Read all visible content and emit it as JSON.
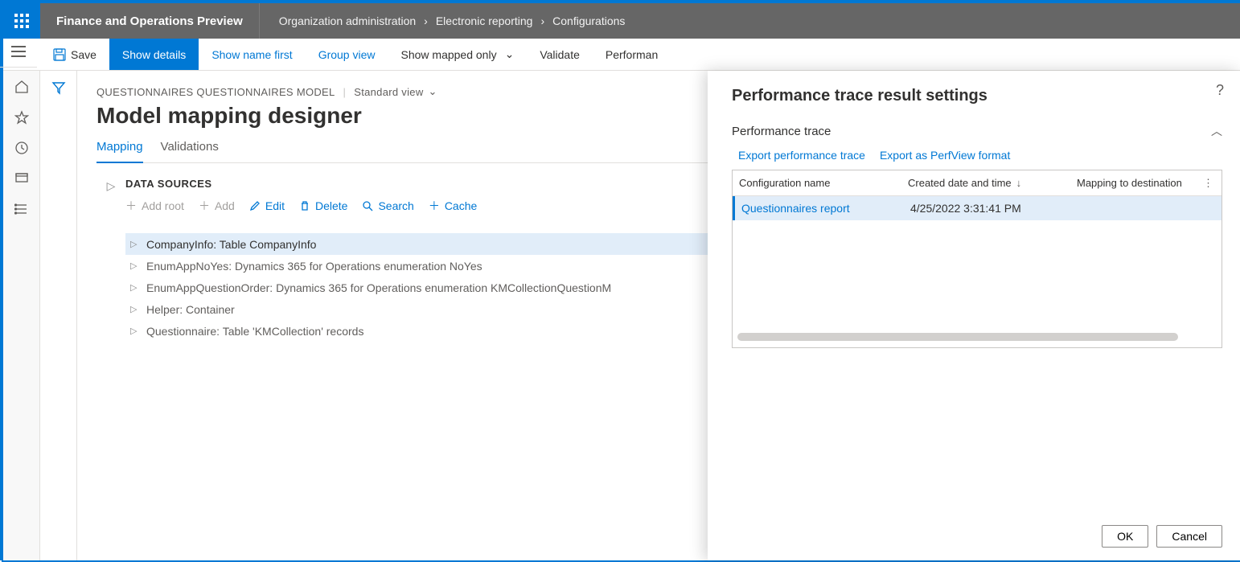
{
  "header": {
    "app_title": "Finance and Operations Preview",
    "breadcrumbs": [
      "Organization administration",
      "Electronic reporting",
      "Configurations"
    ]
  },
  "commands": {
    "save": "Save",
    "show_details": "Show details",
    "show_name_first": "Show name first",
    "group_view": "Group view",
    "show_mapped_only": "Show mapped only",
    "validate": "Validate",
    "performance": "Performan"
  },
  "page": {
    "model": "QUESTIONNAIRES QUESTIONNAIRES MODEL",
    "view": "Standard view",
    "title": "Model mapping designer",
    "tabs": {
      "mapping": "Mapping",
      "validations": "Validations"
    }
  },
  "datasources": {
    "label": "DATA SOURCES",
    "actions": {
      "add_root": "Add root",
      "add": "Add",
      "edit": "Edit",
      "delete": "Delete",
      "search": "Search",
      "cache": "Cache"
    },
    "items": [
      "CompanyInfo: Table CompanyInfo",
      "EnumAppNoYes: Dynamics 365 for Operations enumeration NoYes",
      "EnumAppQuestionOrder: Dynamics 365 for Operations enumeration KMCollectionQuestionM",
      "Helper: Container",
      "Questionnaire: Table 'KMCollection' records"
    ]
  },
  "panel": {
    "title": "Performance trace result settings",
    "section": "Performance trace",
    "links": {
      "export_trace": "Export performance trace",
      "export_perfview": "Export as PerfView format"
    },
    "grid": {
      "columns": {
        "config": "Configuration name",
        "date": "Created date and time",
        "dest": "Mapping to destination"
      },
      "rows": [
        {
          "config": "Questionnaires report",
          "date": "4/25/2022 3:31:41 PM",
          "dest": ""
        }
      ]
    },
    "buttons": {
      "ok": "OK",
      "cancel": "Cancel"
    }
  }
}
